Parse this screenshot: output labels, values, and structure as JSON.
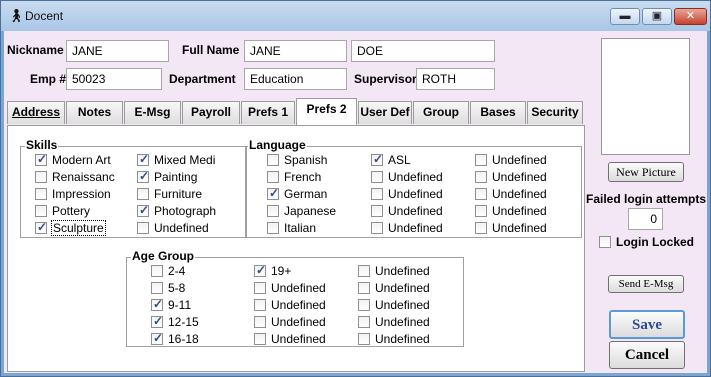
{
  "window": {
    "title": "Docent",
    "min_glyph": "▬",
    "max_glyph": "▣",
    "close_glyph": "✕"
  },
  "form": {
    "nickname_label": "Nickname",
    "nickname": "JANE",
    "fullname_label": "Full Name",
    "first_name": "JANE",
    "last_name": "DOE",
    "emp_label": "Emp #",
    "emp": "50023",
    "department_label": "Department",
    "department": "Education",
    "supervisor_label": "Supervisor",
    "supervisor": "ROTH"
  },
  "tabs": [
    "Address",
    "Notes",
    "E-Msg",
    "Payroll",
    "Prefs 1",
    "Prefs 2",
    "User Def",
    "Group",
    "Bases",
    "Security"
  ],
  "active_tab": "Prefs 2",
  "skills": {
    "title": "Skills",
    "items": [
      {
        "label": "Modern Art",
        "checked": true
      },
      {
        "label": "Renaissanc",
        "checked": false
      },
      {
        "label": "Impression",
        "checked": false
      },
      {
        "label": "Pottery",
        "checked": false
      },
      {
        "label": "Sculpture",
        "checked": true
      },
      {
        "label": "Mixed Medi",
        "checked": true
      },
      {
        "label": "Painting",
        "checked": true
      },
      {
        "label": "Furniture",
        "checked": false
      },
      {
        "label": "Photograph",
        "checked": true
      },
      {
        "label": "Undefined",
        "checked": false
      }
    ]
  },
  "language": {
    "title": "Language",
    "items": [
      {
        "label": "Spanish",
        "checked": false
      },
      {
        "label": "French",
        "checked": false
      },
      {
        "label": "German",
        "checked": true
      },
      {
        "label": "Japanese",
        "checked": false
      },
      {
        "label": "Italian",
        "checked": false
      },
      {
        "label": "ASL",
        "checked": true
      },
      {
        "label": "Undefined",
        "checked": false
      },
      {
        "label": "Undefined",
        "checked": false
      },
      {
        "label": "Undefined",
        "checked": false
      },
      {
        "label": "Undefined",
        "checked": false
      },
      {
        "label": "Undefined",
        "checked": false
      },
      {
        "label": "Undefined",
        "checked": false
      },
      {
        "label": "Undefined",
        "checked": false
      },
      {
        "label": "Undefined",
        "checked": false
      },
      {
        "label": "Undefined",
        "checked": false
      }
    ]
  },
  "age_group": {
    "title": "Age Group",
    "items": [
      {
        "label": "2-4",
        "checked": false
      },
      {
        "label": "5-8",
        "checked": false
      },
      {
        "label": "9-11",
        "checked": true
      },
      {
        "label": "12-15",
        "checked": true
      },
      {
        "label": "16-18",
        "checked": true
      },
      {
        "label": "19+",
        "checked": true
      },
      {
        "label": "Undefined",
        "checked": false
      },
      {
        "label": "Undefined",
        "checked": false
      },
      {
        "label": "Undefined",
        "checked": false
      },
      {
        "label": "Undefined",
        "checked": false
      },
      {
        "label": "Undefined",
        "checked": false
      },
      {
        "label": "Undefined",
        "checked": false
      },
      {
        "label": "Undefined",
        "checked": false
      },
      {
        "label": "Undefined",
        "checked": false
      },
      {
        "label": "Undefined",
        "checked": false
      }
    ]
  },
  "side": {
    "new_picture": "New Picture",
    "failed_label": "Failed login attempts",
    "failed_count": "0",
    "login_locked": {
      "label": "Login Locked",
      "checked": false
    },
    "send_emsg": "Send E-Msg",
    "save": "Save",
    "cancel": "Cancel"
  }
}
